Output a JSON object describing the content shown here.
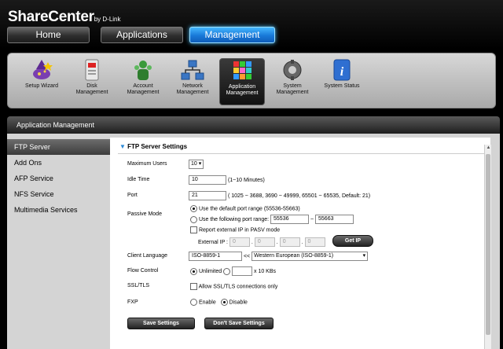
{
  "header": {
    "brand": "ShareCenter",
    "brand_by": "by D-Link",
    "tabs": [
      "Home",
      "Applications",
      "Management"
    ]
  },
  "toolbar": {
    "items": [
      {
        "label": "Setup Wizard",
        "icon": "wizard-icon"
      },
      {
        "label": "Disk\nManagement",
        "icon": "disk-icon"
      },
      {
        "label": "Account\nManagement",
        "icon": "account-icon"
      },
      {
        "label": "Network\nManagement",
        "icon": "network-icon"
      },
      {
        "label": "Application\nManagement",
        "icon": "application-icon"
      },
      {
        "label": "System\nManagement",
        "icon": "system-icon"
      },
      {
        "label": "System Status",
        "icon": "info-icon"
      }
    ]
  },
  "section_title": "Application Management",
  "sidebar": {
    "items": [
      "FTP Server",
      "Add Ons",
      "AFP Service",
      "NFS Service",
      "Multimedia Services"
    ]
  },
  "ftp": {
    "title": "FTP Server Settings",
    "max_users_label": "Maximum Users",
    "max_users_value": "10",
    "idle_time_label": "Idle Time",
    "idle_time_value": "10",
    "idle_time_hint": "(1~10 Minutes)",
    "port_label": "Port",
    "port_value": "21",
    "port_hint": "( 1025 ~ 3688, 3690 ~ 49999, 65501 ~ 65535, Default: 21)",
    "passive_label": "Passive Mode",
    "passive_default": "Use the default port range (55536-55663)",
    "passive_custom": "Use the following port range:",
    "port_range_from": "55536",
    "port_range_sep": "~",
    "port_range_to": "55663",
    "report_ext_ip": "Report external IP in PASV mode",
    "external_ip_label": "External IP :",
    "ip_octets": [
      "0",
      "0",
      "0",
      "0"
    ],
    "ip_dot": ".",
    "get_ip": "Get IP",
    "client_lang_label": "Client Language",
    "client_lang_value": "ISO-8859-1",
    "client_lang_arrow": "<<",
    "client_lang_select": "Western European (ISO-8859-1)",
    "flow_label": "Flow Control",
    "flow_unlimited": "Unlimited",
    "flow_value": "",
    "flow_unit": "x 10 KBs",
    "ssl_label": "SSL/TLS",
    "ssl_option": "Allow SSL/TLS connections only",
    "fxp_label": "FXP",
    "fxp_enable": "Enable",
    "fxp_disable": "Disable",
    "save_label": "Save Settings",
    "dont_save_label": "Don't Save Settings"
  },
  "colors": {
    "active_tab": "#1878d8",
    "title_triangle": "#2a88d6"
  }
}
